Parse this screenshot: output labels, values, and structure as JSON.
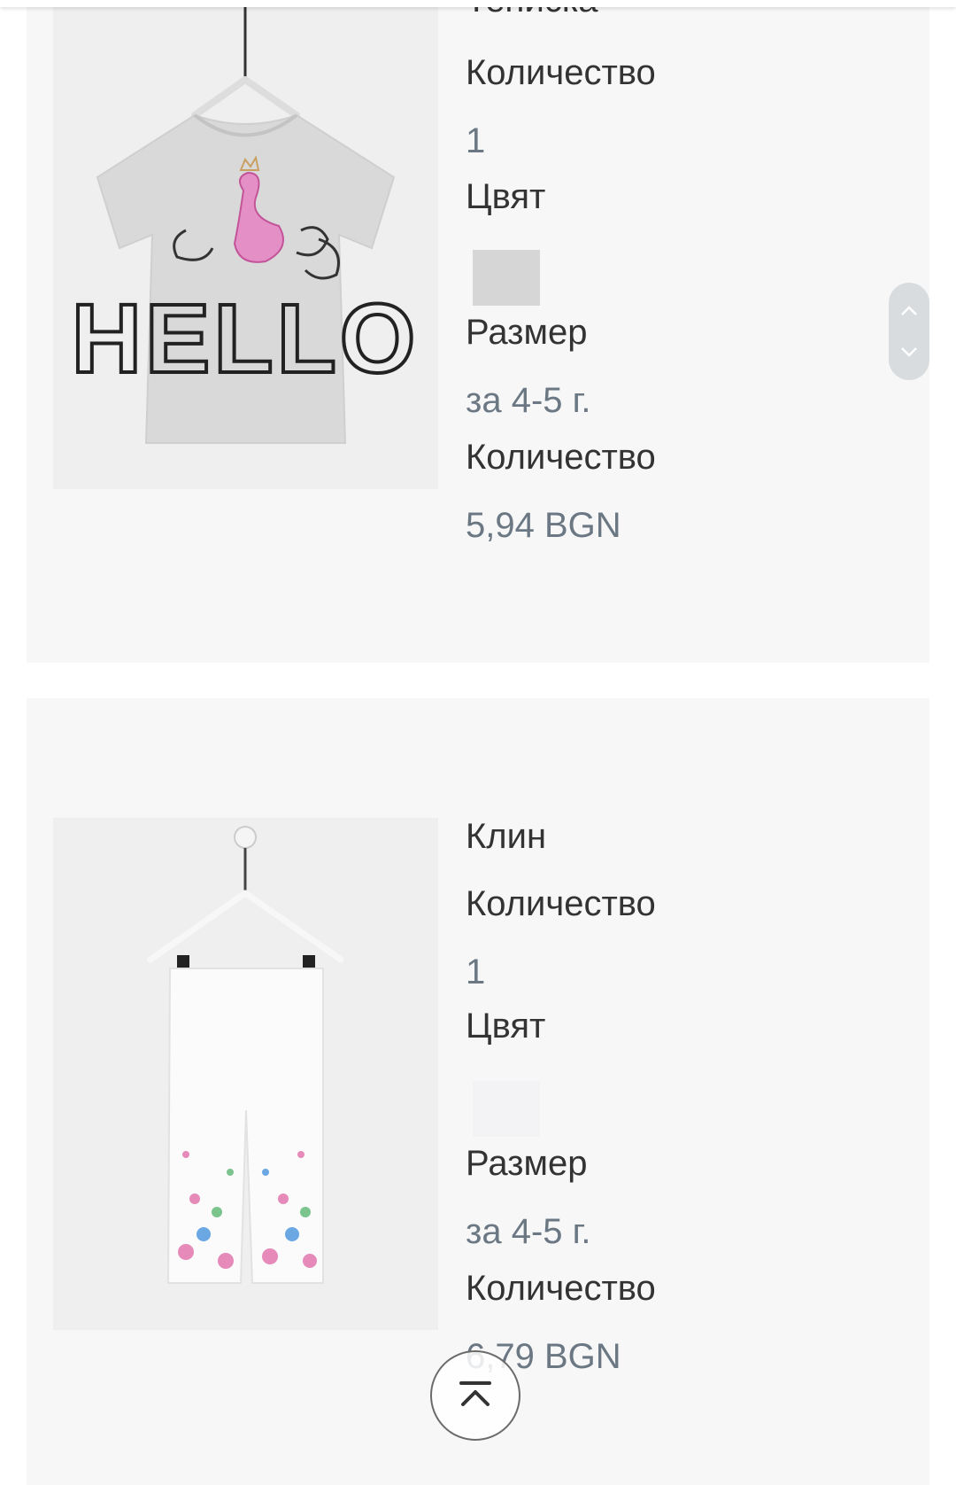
{
  "products": [
    {
      "name": "Тениска",
      "quantity_label": "Количество",
      "quantity_value": "1",
      "color_label": "Цвят",
      "color_swatch": "#d6d6d6",
      "size_label": "Размер",
      "size_value": "за 4-5 г.",
      "price_label": "Количество",
      "price_value": "5,94 BGN",
      "image_icon": "t-shirt-flamingo-image",
      "print_text": "HELLO"
    },
    {
      "name": "Клин",
      "quantity_label": "Количество",
      "quantity_value": "1",
      "color_label": "Цвят",
      "color_swatch": "#f3f3f5",
      "size_label": "Размер",
      "size_value": "за 4-5 г.",
      "price_label": "Количество",
      "price_value": "6,79 BGN",
      "image_icon": "leggings-floral-image"
    }
  ],
  "scroll_control": {
    "up_icon": "chevron-up-icon",
    "down_icon": "chevron-down-icon"
  },
  "back_to_top": {
    "icon": "back-to-top-icon"
  },
  "colors": {
    "card_bg": "#f7f7f7",
    "label": "#333333",
    "value": "#6b7884",
    "image_bg": "#efefef"
  }
}
